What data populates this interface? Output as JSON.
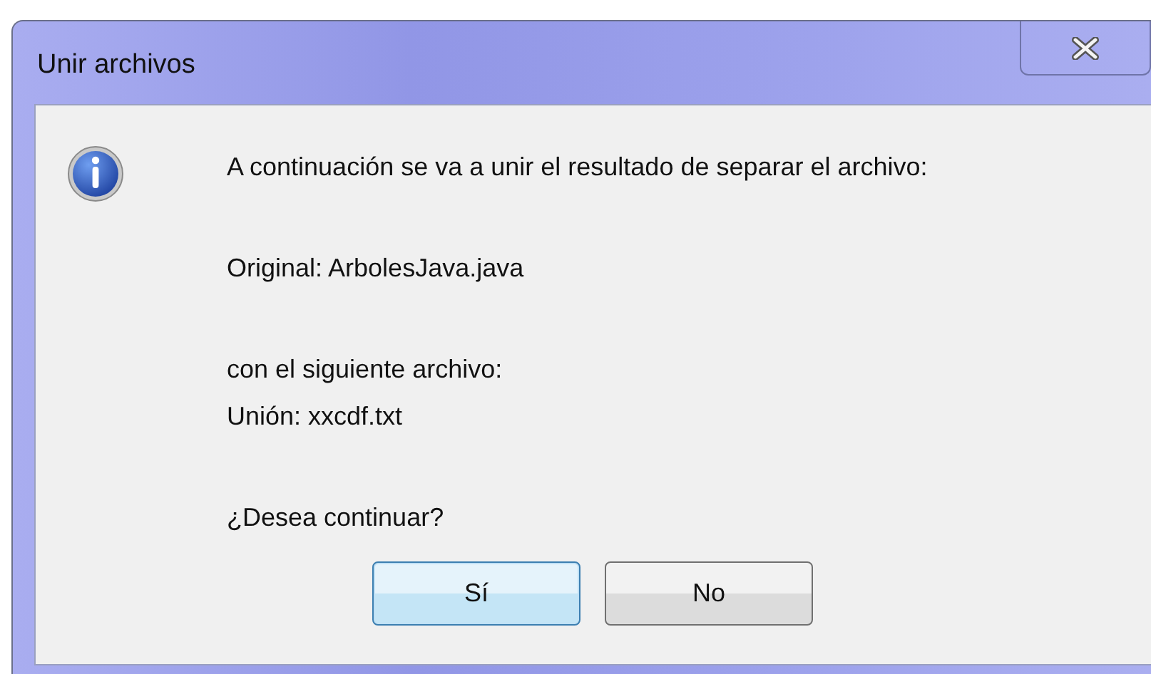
{
  "window": {
    "title": "Unir archivos"
  },
  "message": {
    "paragraphs": [
      [
        "A continuación se va a unir el resultado de separar el archivo:"
      ],
      [
        "Original: ArbolesJava.java"
      ],
      [
        "con el siguiente archivo:",
        "Unión: xxcdf.txt"
      ],
      [
        "¿Desea continuar?"
      ]
    ]
  },
  "buttons": [
    {
      "label": "Sí",
      "selected": true
    },
    {
      "label": "No",
      "selected": false
    }
  ]
}
